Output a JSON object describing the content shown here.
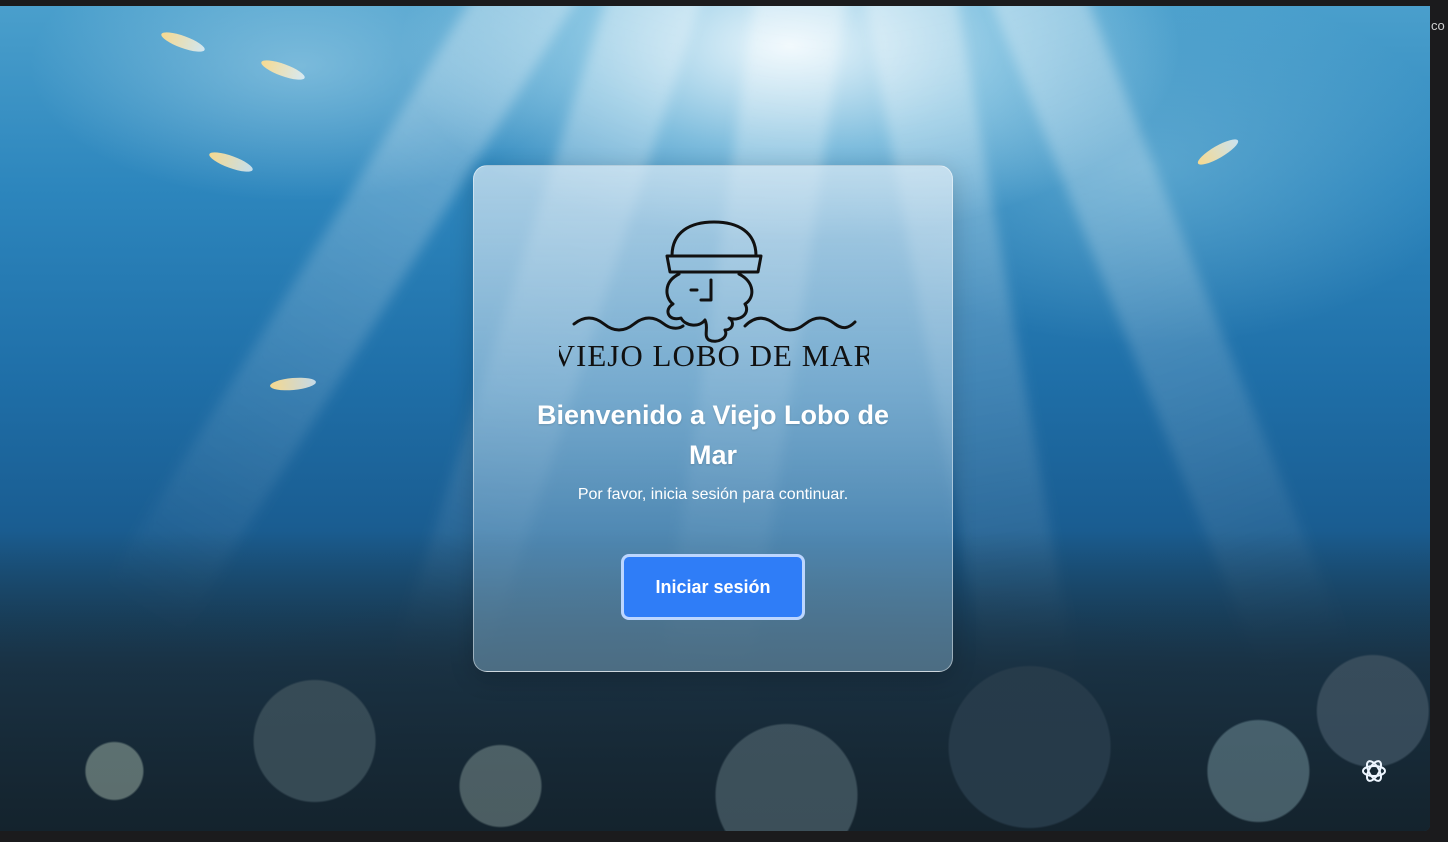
{
  "brand": {
    "logo_text": "VIEJO LOBO DE MAR",
    "logo_icon": "sailor-wolf-logo",
    "accent_color": "#2f7df7"
  },
  "login_card": {
    "title": "Bienvenido a Viejo Lobo de Mar",
    "subtitle": "Por favor, inicia sesión para continuar.",
    "login_button": "Iniciar sesión"
  },
  "overlay": {
    "assistant_icon": "openai-icon",
    "side_text": "co"
  }
}
